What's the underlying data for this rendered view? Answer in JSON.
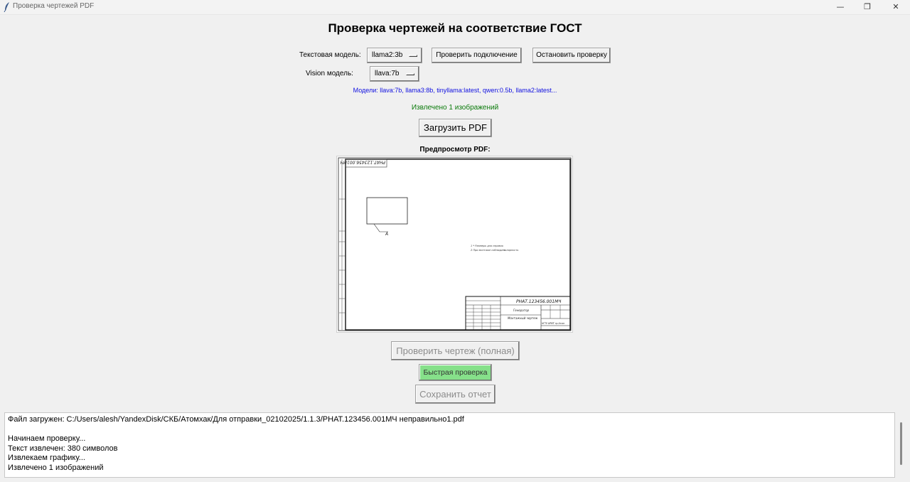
{
  "window": {
    "title": "Проверка чертежей PDF",
    "controls": {
      "minimize": "—",
      "maximize": "❐",
      "close": "✕"
    }
  },
  "header": {
    "title": "Проверка чертежей на соответствие ГОСТ"
  },
  "controls": {
    "text_model_label": "Текстовая модель:",
    "text_model_value": "llama2:3b",
    "check_connection": "Проверить подключение",
    "stop_check": "Остановить проверку",
    "vision_model_label": "Vision модель:",
    "vision_model_value": "llava:7b"
  },
  "models_info": "Модели: llava:7b, llama3:8b, tinyllama:latest, qwen:0.5b, llama2:latest...",
  "extract_status": "Извлечено 1 изображений",
  "load_pdf": "Загрузить PDF",
  "preview": {
    "label": "Предпросмотр PDF:",
    "stamp_number": "РНАТ.123456.001МЧ",
    "corner_number": "РНАТ.123456.001МЧ",
    "title_line1": "Генератор",
    "title_line2": "Монтажный чертеж",
    "org": "НГТУ ИРИТ гр.Атом",
    "view_label": "А",
    "note1": "1 * Размеры для справок",
    "note2": "2 При монтаже соблюдать",
    "note2b": "полярность"
  },
  "actions": {
    "check_full": "Проверить чертеж (полная)",
    "quick_check": "Быстрая проверка",
    "save_report": "Сохранить отчет"
  },
  "colors": {
    "quick_check_bg": "#86e08a",
    "models_info": "#1010e0",
    "status_ok": "#0a7a0a"
  },
  "log": [
    "Файл загружен: C:/Users/alesh/YandexDisk/СКБ/Атомхак/Для отправки_02102025/1.1.3/РНАТ.123456.001МЧ неправильно1.pdf",
    "",
    "Начинаем проверку...",
    "Текст извлечен: 380 символов",
    "Извлекаем графику...",
    "Извлечено 1 изображений"
  ]
}
